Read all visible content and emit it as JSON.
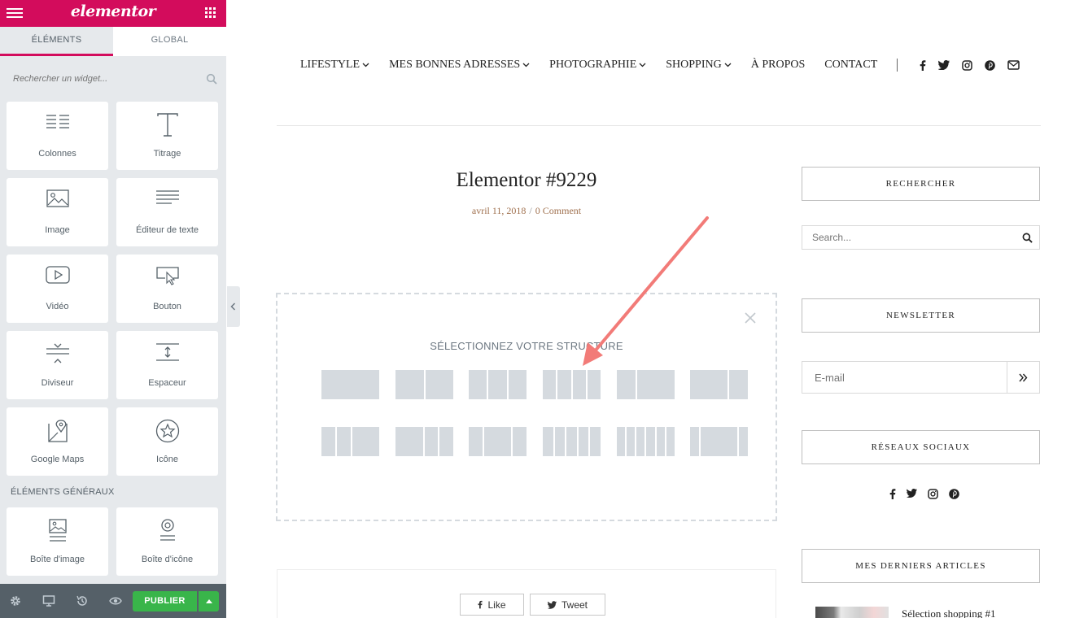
{
  "colors": {
    "brand": "#d30c5c",
    "publish": "#39b54a",
    "panel_bg": "#e6e9ec",
    "footer_bg": "#556068",
    "meta": "#a0714f",
    "arrow": "#f08080"
  },
  "panel": {
    "logo": "elementor",
    "tabs": [
      {
        "label": "ÉLÉMENTS"
      },
      {
        "label": "GLOBAL"
      }
    ],
    "search_placeholder": "Rechercher un widget...",
    "widgets": [
      {
        "label": "Colonnes",
        "icon": "columns-icon"
      },
      {
        "label": "Titrage",
        "icon": "heading-icon"
      },
      {
        "label": "Image",
        "icon": "image-icon"
      },
      {
        "label": "Éditeur de texte",
        "icon": "text-editor-icon"
      },
      {
        "label": "Vidéo",
        "icon": "video-icon"
      },
      {
        "label": "Bouton",
        "icon": "button-icon"
      },
      {
        "label": "Diviseur",
        "icon": "divider-icon"
      },
      {
        "label": "Espaceur",
        "icon": "spacer-icon"
      },
      {
        "label": "Google Maps",
        "icon": "map-icon"
      },
      {
        "label": "Icône",
        "icon": "star-icon"
      }
    ],
    "section_title": "ÉLÉMENTS GÉNÉRAUX",
    "general_widgets": [
      {
        "label": "Boîte d'image",
        "icon": "image-box-icon"
      },
      {
        "label": "Boîte d'icône",
        "icon": "icon-box-icon"
      }
    ],
    "footer": {
      "publish_label": "PUBLIER"
    }
  },
  "site": {
    "nav": [
      {
        "label": "LIFESTYLE",
        "dropdown": true
      },
      {
        "label": "MES BONNES ADRESSES",
        "dropdown": true
      },
      {
        "label": "PHOTOGRAPHIE",
        "dropdown": true
      },
      {
        "label": "SHOPPING",
        "dropdown": true
      },
      {
        "label": "À PROPOS",
        "dropdown": false
      },
      {
        "label": "CONTACT",
        "dropdown": false
      }
    ],
    "social_icons": [
      "facebook-icon",
      "twitter-icon",
      "instagram-icon",
      "pinterest-icon",
      "mail-icon"
    ]
  },
  "post": {
    "title": "Elementor #9229",
    "date": "avril 11, 2018",
    "separator": "/",
    "comments": "0 Comment"
  },
  "structure": {
    "title": "SÉLECTIONNEZ VOTRE STRUCTURE",
    "presets": [
      [
        100
      ],
      [
        50,
        50
      ],
      [
        33,
        33,
        33
      ],
      [
        25,
        25,
        25,
        25
      ],
      [
        33,
        66
      ],
      [
        66,
        33
      ],
      [
        25,
        25,
        50
      ],
      [
        50,
        25,
        25
      ],
      [
        25,
        50,
        25
      ],
      [
        20,
        20,
        20,
        20,
        20
      ],
      [
        16,
        16,
        16,
        16,
        16,
        16
      ],
      [
        16,
        66,
        16
      ]
    ]
  },
  "share": {
    "like": "Like",
    "tweet": "Tweet"
  },
  "sidebar": {
    "search_title": "RECHERCHER",
    "search_placeholder": "Search...",
    "newsletter_title": "NEWSLETTER",
    "email_placeholder": "E-mail",
    "social_title": "RÉSEAUX SOCIAUX",
    "articles_title": "MES DERNIERS ARTICLES",
    "article_1": "Sélection shopping #1"
  }
}
